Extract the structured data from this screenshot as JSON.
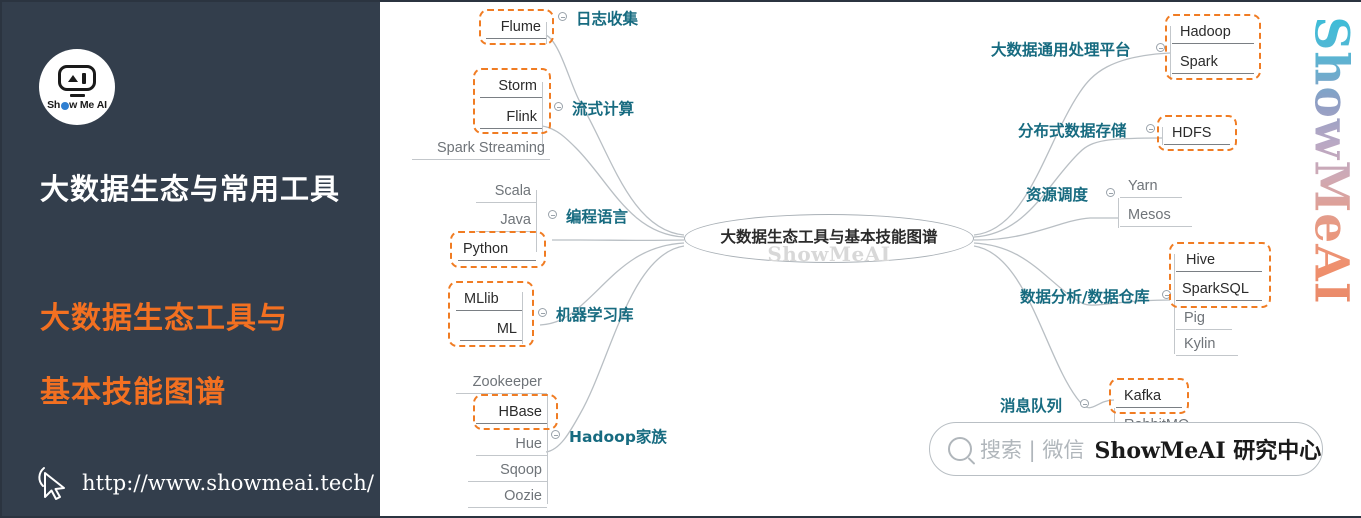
{
  "sidebar": {
    "logo": {
      "icon": "showmeai-robot-logo",
      "wordmark": "Show Me AI"
    },
    "title": "大数据生态与常用工具",
    "subtitle_line1": "大数据生态工具与",
    "subtitle_line2": "基本技能图谱",
    "url": "http://www.showmeai.tech/",
    "cursor_icon": "mouse-cursor-icon",
    "bg_color": "#333e4c",
    "accent_color": "#f37021"
  },
  "mindmap": {
    "center": {
      "label": "大数据生态工具与基本技能图谱",
      "watermark": "ShowMeAI"
    },
    "brand_vertical": "ShowMeAI",
    "topic_color": "#176b80",
    "highlight_color": "#f07c23",
    "branches": [
      {
        "id": "log-collection",
        "label": "日志收集",
        "side": "left",
        "children": [
          {
            "text": "Flume",
            "highlight": true
          }
        ]
      },
      {
        "id": "stream-computing",
        "label": "流式计算",
        "side": "left",
        "children": [
          {
            "text": "Storm",
            "highlight": true
          },
          {
            "text": "Flink",
            "highlight": true
          },
          {
            "text": "Spark Streaming",
            "highlight": false
          }
        ]
      },
      {
        "id": "programming-lang",
        "label": "编程语言",
        "side": "left",
        "children": [
          {
            "text": "Scala",
            "highlight": false
          },
          {
            "text": "Java",
            "highlight": false
          },
          {
            "text": "Python",
            "highlight": true
          }
        ]
      },
      {
        "id": "ml-library",
        "label": "机器学习库",
        "side": "left",
        "children": [
          {
            "text": "MLlib",
            "highlight": true
          },
          {
            "text": "ML",
            "highlight": true
          }
        ]
      },
      {
        "id": "hadoop-family",
        "label": "Hadoop家族",
        "side": "left",
        "children": [
          {
            "text": "Zookeeper",
            "highlight": false
          },
          {
            "text": "HBase",
            "highlight": true
          },
          {
            "text": "Hue",
            "highlight": false
          },
          {
            "text": "Sqoop",
            "highlight": false
          },
          {
            "text": "Oozie",
            "highlight": false
          }
        ]
      },
      {
        "id": "general-platform",
        "label": "大数据通用处理平台",
        "side": "right",
        "children": [
          {
            "text": "Hadoop",
            "highlight": true
          },
          {
            "text": "Spark",
            "highlight": true
          }
        ]
      },
      {
        "id": "distributed-store",
        "label": "分布式数据存储",
        "side": "right",
        "children": [
          {
            "text": "HDFS",
            "highlight": true
          }
        ]
      },
      {
        "id": "resource-sched",
        "label": "资源调度",
        "side": "right",
        "children": [
          {
            "text": "Yarn",
            "highlight": false
          },
          {
            "text": "Mesos",
            "highlight": false
          }
        ]
      },
      {
        "id": "data-analysis",
        "label": "数据分析/数据仓库",
        "side": "right",
        "children": [
          {
            "text": "Hive",
            "highlight": true
          },
          {
            "text": "SparkSQL",
            "highlight": true
          },
          {
            "text": "Pig",
            "highlight": false
          },
          {
            "text": "Kylin",
            "highlight": false
          }
        ]
      },
      {
        "id": "message-queue",
        "label": "消息队列",
        "side": "right",
        "children": [
          {
            "text": "Kafka",
            "highlight": true
          },
          {
            "text": "RabbitMQ",
            "highlight": false
          }
        ]
      }
    ]
  },
  "nodes": {
    "flume": "Flume",
    "storm": "Storm",
    "flink": "Flink",
    "spark_streaming": "Spark Streaming",
    "scala": "Scala",
    "java": "Java",
    "python": "Python",
    "mllib": "MLlib",
    "ml": "ML",
    "zookeeper": "Zookeeper",
    "hbase": "HBase",
    "hue": "Hue",
    "sqoop": "Sqoop",
    "oozie": "Oozie",
    "hadoop": "Hadoop",
    "spark": "Spark",
    "hdfs": "HDFS",
    "yarn": "Yarn",
    "mesos": "Mesos",
    "hive": "Hive",
    "sparksql": "SparkSQL",
    "pig": "Pig",
    "kylin": "Kylin",
    "kafka": "Kafka",
    "rabbitmq": "RabbitMQ"
  },
  "topics": {
    "log_collection": "日志收集",
    "stream_computing": "流式计算",
    "programming_language": "编程语言",
    "ml_library": "机器学习库",
    "hadoop_family": "Hadoop家族",
    "general_platform": "大数据通用处理平台",
    "distributed_storage": "分布式数据存储",
    "resource_scheduling": "资源调度",
    "data_analysis": "数据分析/数据仓库",
    "message_queue": "消息队列"
  },
  "watermark_bar": {
    "search_placeholder": "搜索 | 微信",
    "brand": "ShowMeAI 研究中心",
    "search_icon": "magnifier-icon"
  }
}
